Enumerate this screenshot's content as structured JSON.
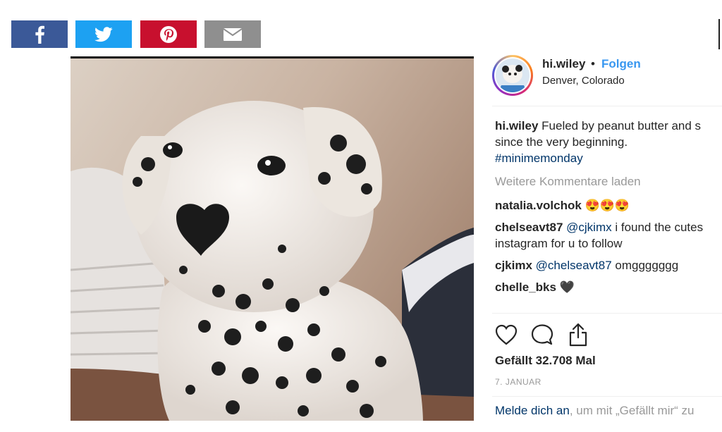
{
  "share": {
    "facebook_icon": "facebook-f-icon",
    "twitter_icon": "twitter-bird-icon",
    "pinterest_icon": "pinterest-p-icon",
    "email_icon": "envelope-icon",
    "colors": {
      "facebook": "#3b5998",
      "twitter": "#1da1f2",
      "pinterest": "#c8102e",
      "email": "#8f8f8f"
    }
  },
  "post": {
    "username": "hi.wiley",
    "separator": "•",
    "follow_label": "Folgen",
    "location": "Denver, Colorado",
    "caption": {
      "author": "hi.wiley",
      "text_line1": "Fueled by peanut butter and s",
      "text_line2": "since the very beginning.",
      "hashtag": "#minimemonday"
    },
    "load_more": "Weitere Kommentare laden",
    "comments": [
      {
        "user": "natalia.volchok",
        "text": "😍😍😍"
      },
      {
        "user": "chelseavt87",
        "mention": "@cjkimx",
        "text": " i found the cutes",
        "text2": "instagram for u to follow"
      },
      {
        "user": "cjkimx",
        "mention": "@chelseavt87",
        "text": " omggggggg"
      },
      {
        "user": "chelle_bks",
        "text": "🖤"
      }
    ],
    "actions": {
      "like_icon": "heart-icon",
      "comment_icon": "speech-bubble-icon",
      "share_icon": "share-upload-icon"
    },
    "likes": "Gefällt 32.708 Mal",
    "date": "7. JANUAR",
    "login": {
      "link": "Melde dich an",
      "rest": ", um mit „Gefällt mir“ zu"
    },
    "accent_color": "#3897f0"
  }
}
